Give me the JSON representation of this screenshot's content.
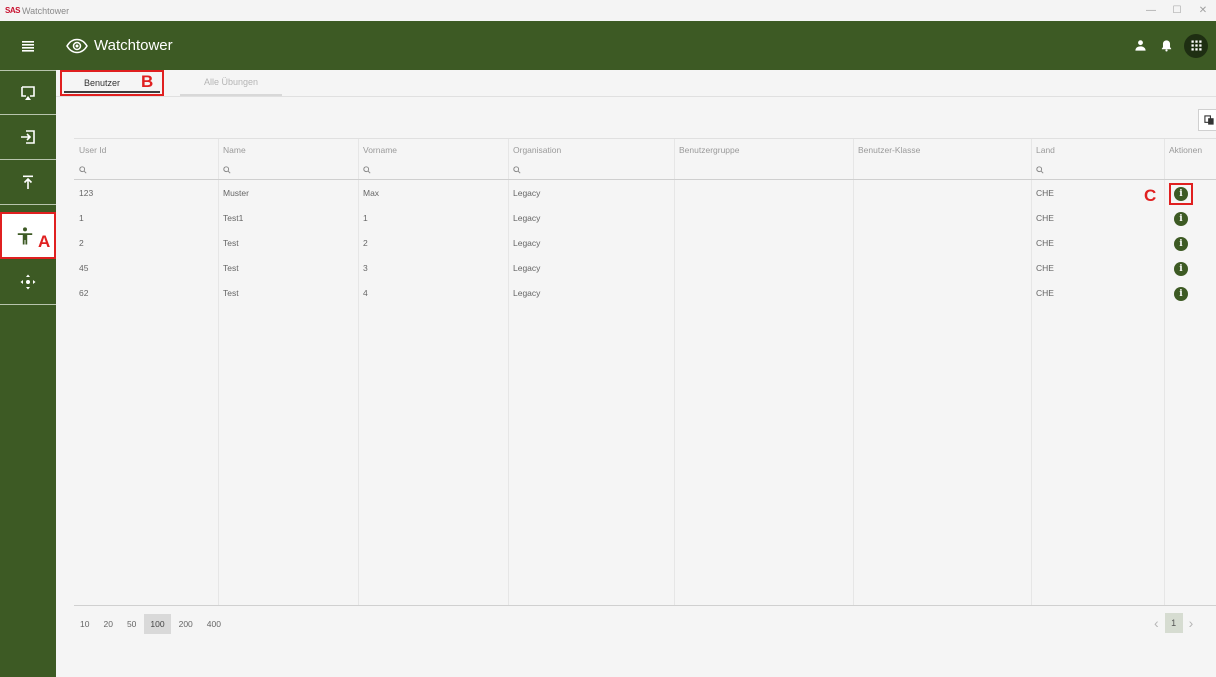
{
  "window": {
    "logo_text": "SAS",
    "title": "Watchtower",
    "controls": [
      "—",
      "☐",
      "✕"
    ]
  },
  "header": {
    "app_title": "Watchtower",
    "icons": [
      "person-icon",
      "bell-icon",
      "apps-grid-icon"
    ]
  },
  "sidebar": {
    "items": [
      {
        "name": "menu",
        "icon": "hamburger-icon"
      },
      {
        "name": "cast",
        "icon": "cast-icon"
      },
      {
        "name": "login",
        "icon": "login-icon"
      },
      {
        "name": "upload",
        "icon": "upload-icon"
      },
      {
        "name": "accessibility",
        "icon": "accessibility-icon",
        "active": true
      },
      {
        "name": "move",
        "icon": "move-icon"
      }
    ]
  },
  "markers": {
    "a": "A",
    "b": "B",
    "c": "C"
  },
  "tabs": [
    {
      "label": "Benutzer",
      "active": true
    },
    {
      "label": "Alle Übungen",
      "active": false
    }
  ],
  "grid": {
    "columns": [
      "User Id",
      "Name",
      "Vorname",
      "Organisation",
      "Benutzergruppe",
      "Benutzer-Klasse",
      "Land",
      "Aktionen"
    ],
    "rows": [
      {
        "user_id": "123",
        "name": "Muster",
        "vorname": "Max",
        "organisation": "Legacy",
        "benutzergruppe": "",
        "klasse": "",
        "land": "CHE"
      },
      {
        "user_id": "1",
        "name": "Test1",
        "vorname": "1",
        "organisation": "Legacy",
        "benutzergruppe": "",
        "klasse": "",
        "land": "CHE"
      },
      {
        "user_id": "2",
        "name": "Test",
        "vorname": "2",
        "organisation": "Legacy",
        "benutzergruppe": "",
        "klasse": "",
        "land": "CHE"
      },
      {
        "user_id": "45",
        "name": "Test",
        "vorname": "3",
        "organisation": "Legacy",
        "benutzergruppe": "",
        "klasse": "",
        "land": "CHE"
      },
      {
        "user_id": "62",
        "name": "Test",
        "vorname": "4",
        "organisation": "Legacy",
        "benutzergruppe": "",
        "klasse": "",
        "land": "CHE"
      }
    ],
    "action_icon": "i"
  },
  "pager": {
    "sizes": [
      "10",
      "20",
      "50",
      "100",
      "200",
      "400"
    ],
    "selected_size": "100",
    "current_page": "1",
    "prev": "‹",
    "next": "›"
  },
  "colors": {
    "primary": "#3d5a24",
    "marker": "#e02020"
  }
}
